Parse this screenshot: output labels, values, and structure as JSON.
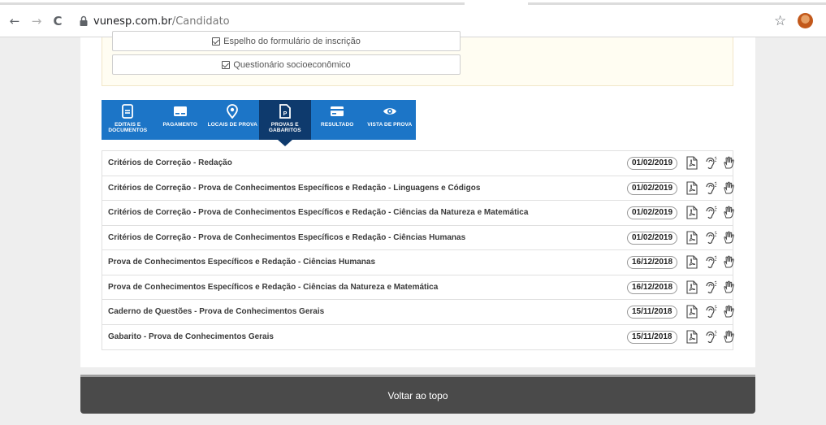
{
  "browser": {
    "url_host": "vunesp.com.br",
    "url_path": "/Candidato",
    "back_glyph": "←",
    "forward_glyph": "→",
    "reload_glyph": "C",
    "star_glyph": "☆",
    "menu_glyph": "⋮"
  },
  "documents": {
    "items": [
      {
        "label": "Espelho do formulário de inscrição"
      },
      {
        "label": "Questionário socioeconômico"
      }
    ]
  },
  "tabs": [
    {
      "label": "EDITAIS E DOCUMENTOS",
      "icon": "document-icon",
      "active": false
    },
    {
      "label": "PAGAMENTO",
      "icon": "payment-icon",
      "active": false
    },
    {
      "label": "LOCAIS DE PROVA",
      "icon": "location-icon",
      "active": false
    },
    {
      "label": "PROVAS E GABARITOS",
      "icon": "pdf-file-icon",
      "active": true
    },
    {
      "label": "RESULTADO",
      "icon": "card-icon",
      "active": false
    },
    {
      "label": "VISTA DE PROVA",
      "icon": "eye-icon",
      "active": false
    }
  ],
  "rows": [
    {
      "title": "Critérios de Correção - Redação",
      "date": "01/02/2019"
    },
    {
      "title": "Critérios de Correção - Prova de Conhecimentos Específicos e Redação - Linguagens e Códigos",
      "date": "01/02/2019"
    },
    {
      "title": "Critérios de Correção - Prova de Conhecimentos Específicos e Redação - Ciências da Natureza e Matemática",
      "date": "01/02/2019"
    },
    {
      "title": "Critérios de Correção - Prova de Conhecimentos Específicos e Redação - Ciências Humanas",
      "date": "01/02/2019"
    },
    {
      "title": "Prova de Conhecimentos Específicos e Redação - Ciências Humanas",
      "date": "16/12/2018"
    },
    {
      "title": "Prova de Conhecimentos Específicos e Redação - Ciências da Natureza e Matemática",
      "date": "16/12/2018"
    },
    {
      "title": "Caderno de Questões - Prova de Conhecimentos Gerais",
      "date": "15/11/2018"
    },
    {
      "title": "Gabarito - Prova de Conhecimentos Gerais",
      "date": "15/11/2018"
    }
  ],
  "footer": {
    "back_to_top": "Voltar ao topo"
  },
  "colors": {
    "tab": "#1c75c7",
    "tab_active": "#0e3a6d",
    "footer": "#4a4a4a"
  }
}
